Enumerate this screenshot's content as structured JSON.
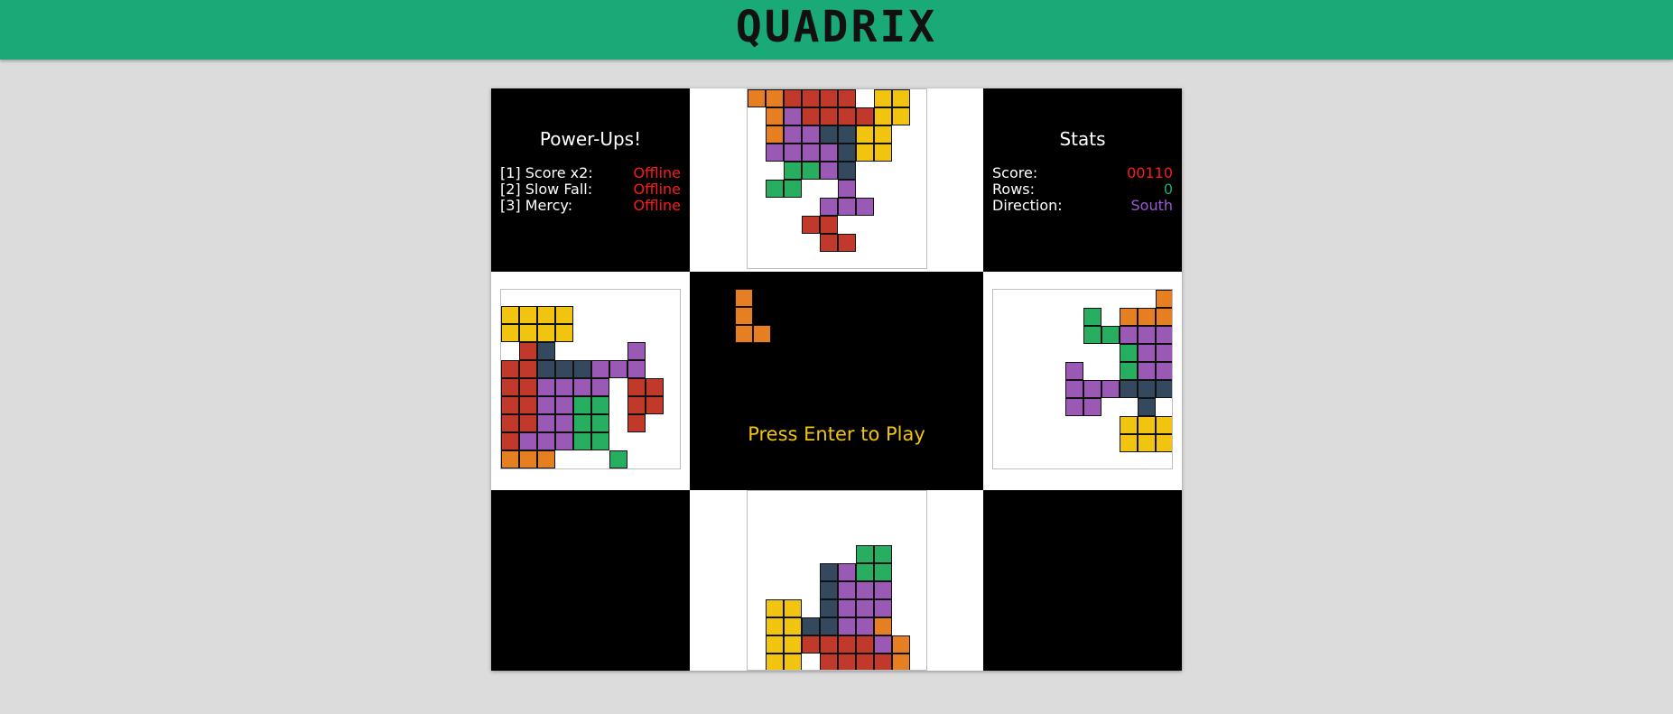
{
  "header": {
    "title": "QUADRIX"
  },
  "powerups": {
    "title": "Power-Ups!",
    "items": [
      {
        "label": "[1] Score x2:",
        "status": "Offline"
      },
      {
        "label": "[2] Slow Fall:",
        "status": "Offline"
      },
      {
        "label": "[3] Mercy:",
        "status": "Offline"
      }
    ]
  },
  "stats": {
    "title": "Stats",
    "score_label": "Score:",
    "score_value": "00110",
    "rows_label": "Rows:",
    "rows_value": "0",
    "direction_label": "Direction:",
    "direction_value": "South"
  },
  "center": {
    "prompt": "Press Enter to Play"
  },
  "colors": {
    "header": "#1aaa78",
    "orange": "#e67e22",
    "red": "#c0392b",
    "purple": "#9b59b6",
    "yellow": "#f1c40f",
    "green": "#27ae60",
    "navy": "#34495e",
    "offline": "#ff1a1a",
    "rows_value": "#1aaa78",
    "direction_value": "#9b59d6",
    "prompt": "#f1c40f"
  },
  "wells": {
    "north": [
      "oorrrr.yy",
      ".oprrrryy",
      ".oppnnyy.",
      ".ppppnyy.",
      "..ggpn...",
      ".gg..p...",
      "....ppp..",
      "...rr....",
      "....rr..."
    ],
    "west": [
      ".........",
      "yyyy.....",
      "yyyy.....",
      ".rn....p.",
      "rrnnnppp.",
      "rrpppp.rr",
      "rrppgg.rr",
      "rrppgg.r.",
      "rpppgg...",
      "ooo...g..",
      "o........"
    ],
    "east": [
      "........o",
      "....g.ooo",
      "....ggppp",
      "......gpp",
      "...p..gpp",
      "...pppnnn",
      "...pp..n.",
      "......yyy",
      "......yyy"
    ],
    "south": [
      "......gg.",
      "....npgg.",
      "....nppp.",
      ".yy.nppp.",
      ".yynnppo.",
      ".yyrrrrpo",
      ".yy.rrrro"
    ],
    "preview": [
      "o.",
      "o.",
      "oo"
    ]
  }
}
